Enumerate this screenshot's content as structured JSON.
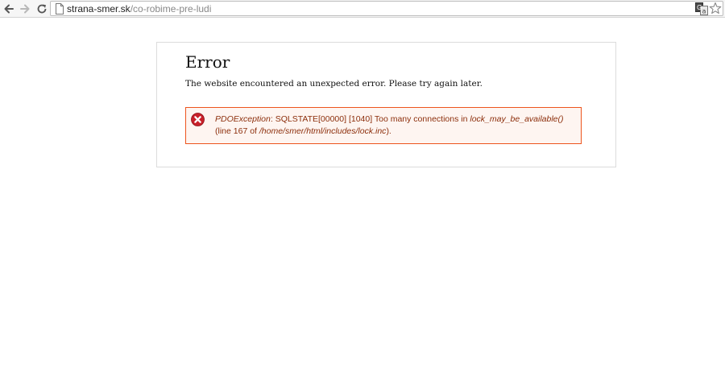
{
  "browser": {
    "url_host": "strana-smer.sk",
    "url_path": "/co-robime-pre-ludi",
    "icons": [
      "back-arrow-icon",
      "forward-arrow-icon",
      "reload-icon",
      "page-icon",
      "translate-icon",
      "star-icon"
    ]
  },
  "page": {
    "title": "Error",
    "message": "The website encountered an unexpected error. Please try again later."
  },
  "error": {
    "exception": "PDOException",
    "text_1": ": SQLSTATE[00000] [1040] Too many connections in ",
    "function": "lock_may_be_available()",
    "text_2": " (line 167 of ",
    "file": "/home/smer/html/includes/lock.inc",
    "text_3": ")."
  },
  "colors": {
    "error_border": "#ed541d",
    "error_background": "#fef5f1",
    "error_text": "#8c2e0b",
    "error_icon": "#c8202a"
  }
}
